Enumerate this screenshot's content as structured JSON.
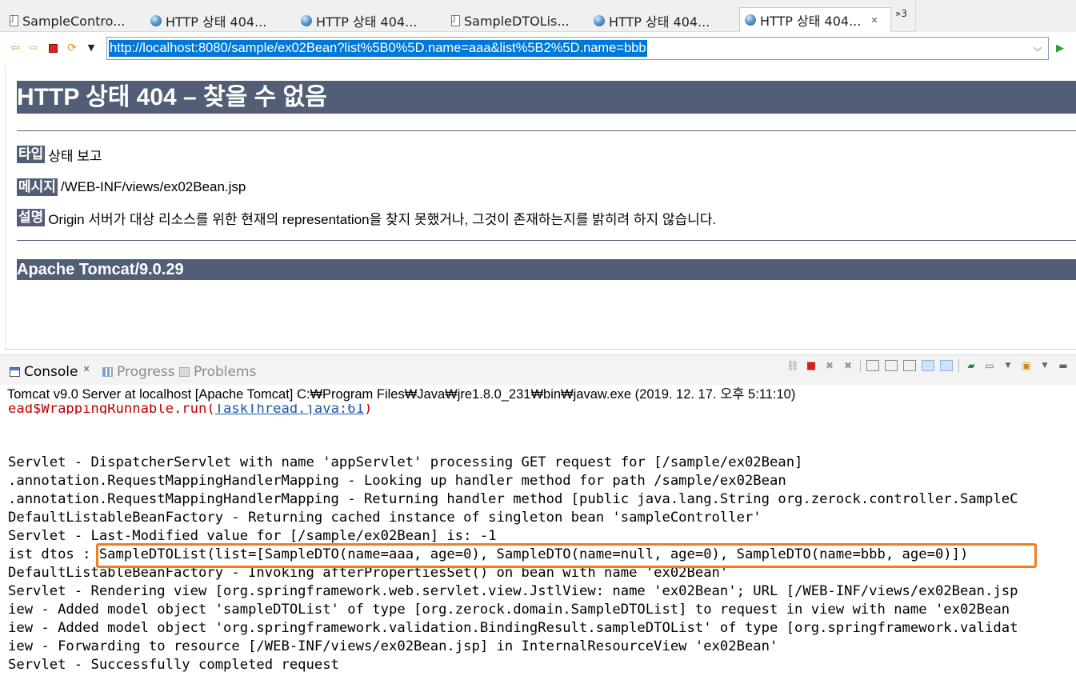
{
  "editor_tabs": [
    {
      "label": "SampleContro...",
      "icon": "java-file-icon"
    },
    {
      "label": "HTTP 상태 404...",
      "icon": "globe-icon"
    },
    {
      "label": "HTTP 상태 404...",
      "icon": "globe-icon"
    },
    {
      "label": "SampleDTOLis...",
      "icon": "java-file-icon"
    },
    {
      "label": "HTTP 상태 404...",
      "icon": "globe-icon"
    },
    {
      "label": "HTTP 상태 404...",
      "icon": "globe-icon",
      "active": true
    }
  ],
  "tab_overflow": "»3",
  "browser": {
    "url": "http://localhost:8080/sample/ex02Bean?list%5B0%5D.name=aaa&list%5B2%5D.name=bbb"
  },
  "page": {
    "title": "HTTP 상태 404 – 찾을 수 없음",
    "type_label": "타입",
    "type_value": "상태 보고",
    "message_label": "메시지",
    "message_value": "/WEB-INF/views/ex02Bean.jsp",
    "description_label": "설명",
    "description_value": "Origin 서버가 대상 리소스를 위한 현재의 representation을 찾지 못했거나, 그것이 존재하는지를 밝히려 하지 않습니다.",
    "server": "Apache Tomcat/9.0.29",
    "accent_color": "#525d76"
  },
  "views": {
    "console": "Console",
    "progress": "Progress",
    "problems": "Problems"
  },
  "console": {
    "header": "Tomcat v9.0 Server at localhost [Apache Tomcat] C:₩Program Files₩Java₩jre1.8.0_231₩bin₩javaw.exe (2019. 12. 17. 오후 5:11:10)",
    "error_line_prefix": "ead$WrappingRunnable.run(",
    "error_line_link": "TaskThread.java:61",
    "error_line_suffix": ")",
    "lines": [
      "Servlet - DispatcherServlet with name 'appServlet' processing GET request for [/sample/ex02Bean]",
      ".annotation.RequestMappingHandlerMapping - Looking up handler method for path /sample/ex02Bean",
      ".annotation.RequestMappingHandlerMapping - Returning handler method [public java.lang.String org.zerock.controller.SampleC",
      "DefaultListableBeanFactory - Returning cached instance of singleton bean 'sampleController'",
      "Servlet - Last-Modified value for [/sample/ex02Bean] is: -1",
      "ist dtos : SampleDTOList(list=[SampleDTO(name=aaa, age=0), SampleDTO(name=null, age=0), SampleDTO(name=bbb, age=0)])",
      "DefaultListableBeanFactory - Invoking afterPropertiesSet() on bean with name 'ex02Bean'",
      "Servlet - Rendering view [org.springframework.web.servlet.view.JstlView: name 'ex02Bean'; URL [/WEB-INF/views/ex02Bean.jsp",
      "iew - Added model object 'sampleDTOList' of type [org.zerock.domain.SampleDTOList] to request in view with name 'ex02Bean",
      "iew - Added model object 'org.springframework.validation.BindingResult.sampleDTOList' of type [org.springframework.validat",
      "iew - Forwarding to resource [/WEB-INF/views/ex02Bean.jsp] in InternalResourceView 'ex02Bean'",
      "Servlet - Successfully completed request"
    ],
    "highlight_color": "#f07c1c"
  }
}
